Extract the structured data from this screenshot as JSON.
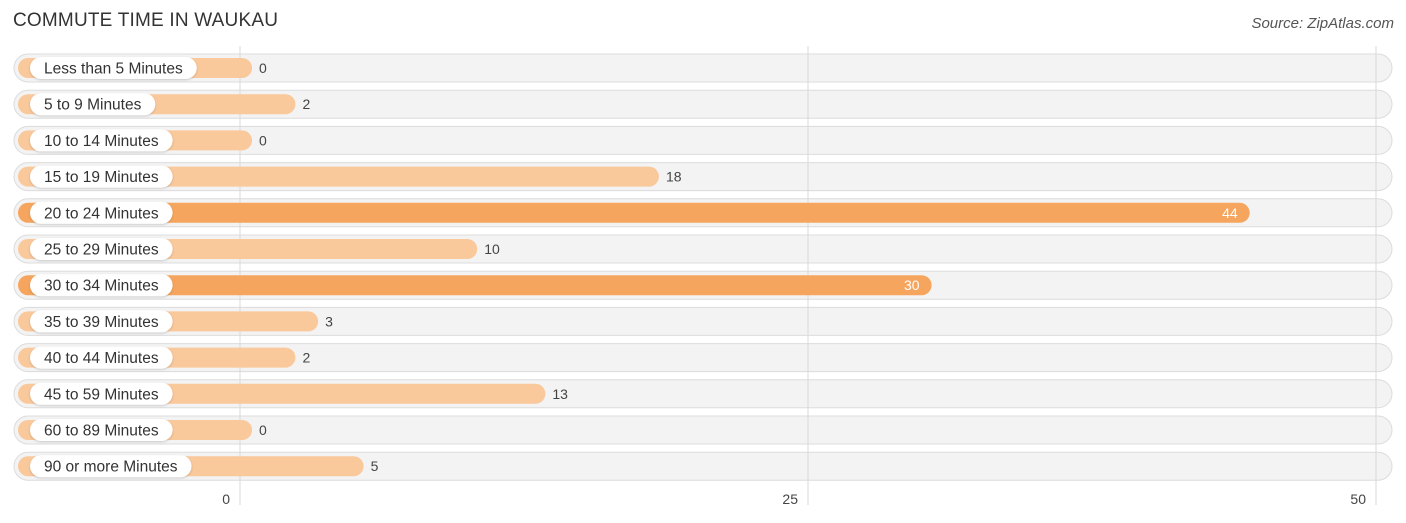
{
  "chart_data": {
    "type": "bar",
    "orientation": "horizontal",
    "title": "COMMUTE TIME IN WAUKAU",
    "source": "Source: ZipAtlas.com",
    "categories": [
      "Less than 5 Minutes",
      "5 to 9 Minutes",
      "10 to 14 Minutes",
      "15 to 19 Minutes",
      "20 to 24 Minutes",
      "25 to 29 Minutes",
      "30 to 34 Minutes",
      "35 to 39 Minutes",
      "40 to 44 Minutes",
      "45 to 59 Minutes",
      "60 to 89 Minutes",
      "90 or more Minutes"
    ],
    "values": [
      0,
      2,
      0,
      18,
      44,
      10,
      30,
      3,
      2,
      13,
      0,
      5
    ],
    "xlabel": "",
    "ylabel": "",
    "xlim": [
      0,
      50
    ],
    "xticks": [
      0,
      25,
      50
    ],
    "grid": true,
    "colors": {
      "normal": "#f9c89b",
      "highlight": "#f5a55d",
      "track": "#f2f2f2"
    },
    "highlight_threshold": 30
  }
}
